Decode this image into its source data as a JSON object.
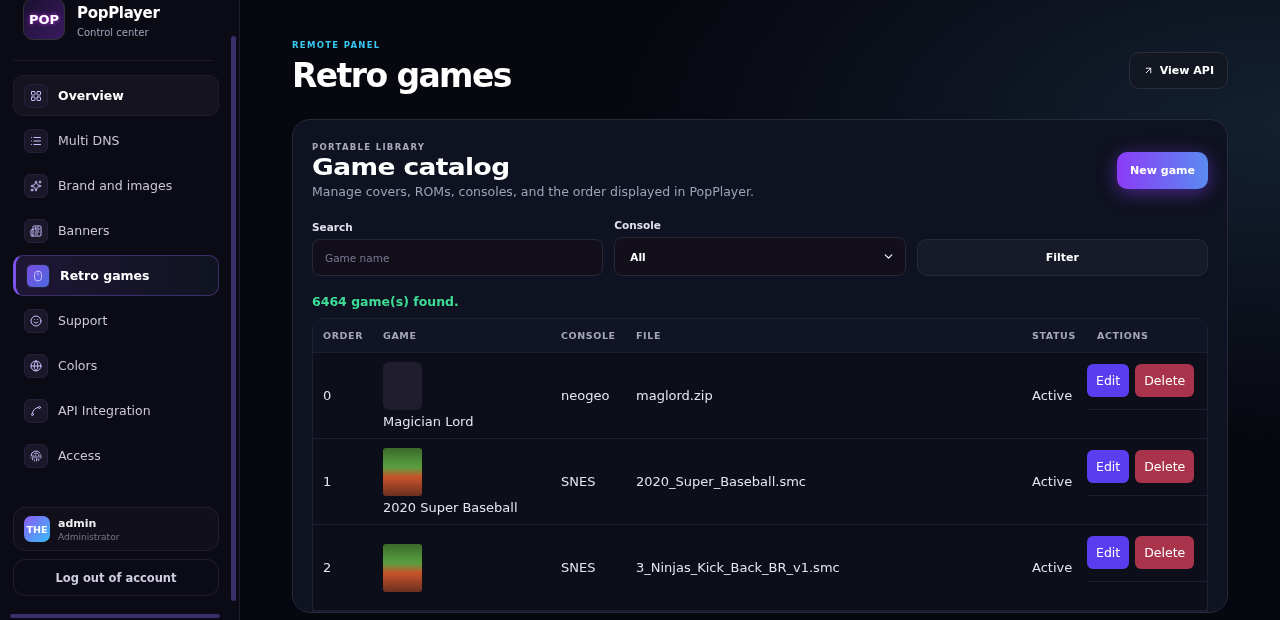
{
  "brand": {
    "logo_mark": "POP",
    "name": "PopPlayer",
    "subtitle": "Control center"
  },
  "sidebar": {
    "items": [
      {
        "label": "Overview",
        "selected": false,
        "hovered": true
      },
      {
        "label": "Multi DNS",
        "selected": false,
        "hovered": false
      },
      {
        "label": "Brand and images",
        "selected": false,
        "hovered": false
      },
      {
        "label": "Banners",
        "selected": false,
        "hovered": false
      },
      {
        "label": "Retro games",
        "selected": true,
        "hovered": false
      },
      {
        "label": "Support",
        "selected": false,
        "hovered": false
      },
      {
        "label": "Colors",
        "selected": false,
        "hovered": false
      },
      {
        "label": "API Integration",
        "selected": false,
        "hovered": false
      },
      {
        "label": "Access",
        "selected": false,
        "hovered": false
      }
    ],
    "user": {
      "avatar": "THE",
      "name": "admin",
      "role": "Administrator"
    },
    "logout": "Log out of account"
  },
  "header": {
    "eyebrow": "REMOTE PANEL",
    "title": "Retro games",
    "action": "View API"
  },
  "card": {
    "eyebrow": "PORTABLE LIBRARY",
    "title": "Game catalog",
    "description": "Manage covers, ROMs, consoles, and the order displayed in PopPlayer.",
    "primary_button": "New game",
    "filters": {
      "search_label": "Search",
      "search_placeholder": "Game name",
      "console_label": "Console",
      "console_value": "All",
      "filter_button": "Filter"
    },
    "result_count": "6464 game(s) found.",
    "table": {
      "columns": [
        "ORDER",
        "GAME",
        "CONSOLE",
        "FILE",
        "STATUS",
        "ACTIONS"
      ],
      "rows": [
        {
          "order": "0",
          "kind": "blank",
          "game": "Magician Lord",
          "console": "neogeo",
          "file": "maglord.zip",
          "status": "Active",
          "actions": [
            "Edit",
            "Delete"
          ]
        },
        {
          "order": "1",
          "kind": "cover",
          "game": "2020 Super Baseball",
          "console": "SNES",
          "file": "2020_Super_Baseball.smc",
          "status": "Active",
          "actions": [
            "Edit",
            "Delete"
          ]
        },
        {
          "order": "2",
          "kind": "cover",
          "console": "SNES",
          "file": "3_Ninjas_Kick_Back_BR_v1.smc",
          "status": "Active",
          "actions": [
            "Edit",
            "Delete"
          ]
        }
      ]
    }
  }
}
